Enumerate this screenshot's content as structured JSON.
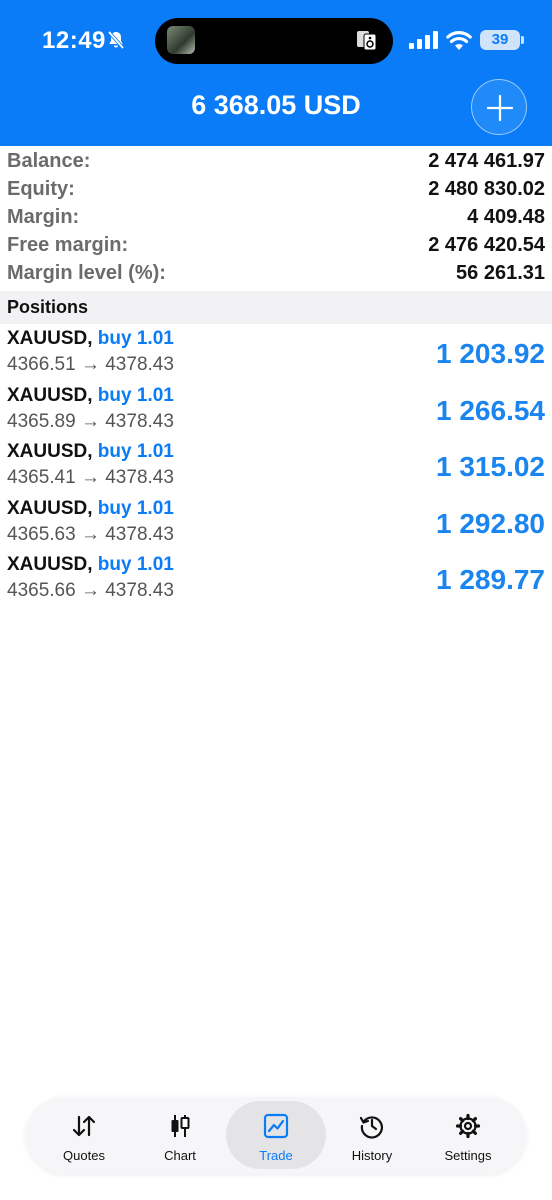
{
  "status_bar": {
    "time": "12:49",
    "battery": "39"
  },
  "header": {
    "title": "6 368.05 USD"
  },
  "summary": [
    {
      "label": "Balance:",
      "value": "2 474 461.97"
    },
    {
      "label": "Equity:",
      "value": "2 480 830.02"
    },
    {
      "label": "Margin:",
      "value": "4 409.48"
    },
    {
      "label": "Free margin:",
      "value": "2 476 420.54"
    },
    {
      "label": "Margin level (%):",
      "value": "56 261.31"
    }
  ],
  "positions_title": "Positions",
  "positions": [
    {
      "symbol": "XAUUSD,",
      "side": "buy 1.01",
      "prices": "4366.51 → 4378.43",
      "profit": "1 203.92"
    },
    {
      "symbol": "XAUUSD,",
      "side": "buy 1.01",
      "prices": "4365.89 → 4378.43",
      "profit": "1 266.54"
    },
    {
      "symbol": "XAUUSD,",
      "side": "buy 1.01",
      "prices": "4365.41 → 4378.43",
      "profit": "1 315.02"
    },
    {
      "symbol": "XAUUSD,",
      "side": "buy 1.01",
      "prices": "4365.63 → 4378.43",
      "profit": "1 292.80"
    },
    {
      "symbol": "XAUUSD,",
      "side": "buy 1.01",
      "prices": "4365.66 → 4378.43",
      "profit": "1 289.77"
    }
  ],
  "tabs": [
    {
      "label": "Quotes",
      "icon": "quotes-icon"
    },
    {
      "label": "Chart",
      "icon": "chart-icon"
    },
    {
      "label": "Trade",
      "icon": "trade-icon",
      "active": true
    },
    {
      "label": "History",
      "icon": "history-icon"
    },
    {
      "label": "Settings",
      "icon": "settings-icon"
    }
  ],
  "colors": {
    "accent": "#0a7cf7",
    "profit": "#1a84ef"
  }
}
